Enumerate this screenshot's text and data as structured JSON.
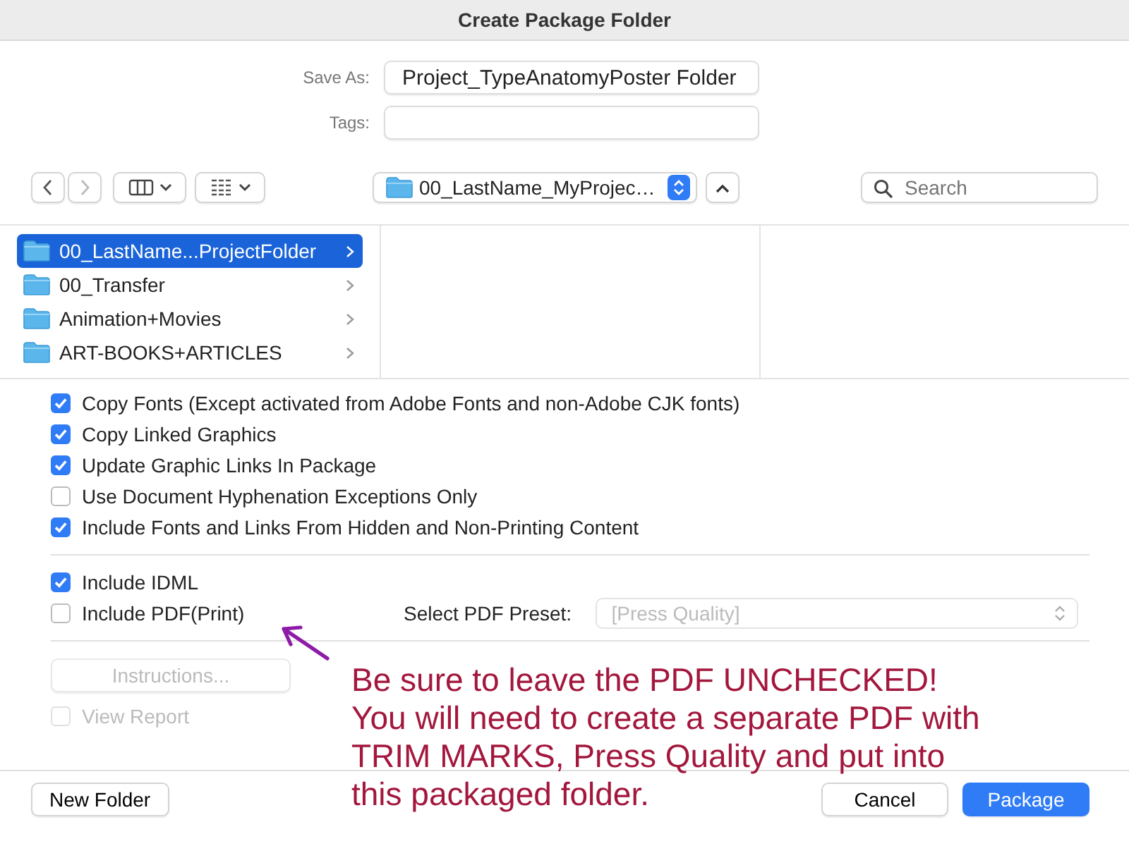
{
  "window": {
    "title": "Create Package Folder"
  },
  "save_as": {
    "label": "Save As:",
    "value": "Project_TypeAnatomyPoster Folder"
  },
  "tags": {
    "label": "Tags:"
  },
  "toolbar": {
    "location": "00_LastName_MyProjec…",
    "search": {
      "placeholder": "Search"
    }
  },
  "browser": {
    "items": [
      {
        "name": "00_LastName...ProjectFolder",
        "selected": true
      },
      {
        "name": "00_Transfer",
        "selected": false
      },
      {
        "name": "Animation+Movies",
        "selected": false
      },
      {
        "name": "ART-BOOKS+ARTICLES",
        "selected": false
      }
    ]
  },
  "options": [
    {
      "label": "Copy Fonts (Except activated from Adobe Fonts and non-Adobe CJK fonts)",
      "checked": true
    },
    {
      "label": "Copy Linked Graphics",
      "checked": true
    },
    {
      "label": "Update Graphic Links In Package",
      "checked": true
    },
    {
      "label": "Use Document Hyphenation Exceptions Only",
      "checked": false
    },
    {
      "label": "Include Fonts and Links From Hidden and Non-Printing Content",
      "checked": true
    }
  ],
  "include": [
    {
      "label": "Include IDML",
      "checked": true
    },
    {
      "label": "Include PDF(Print)",
      "checked": false
    }
  ],
  "pdf_preset": {
    "label": "Select PDF Preset:",
    "value": "[Press Quality]",
    "disabled": true
  },
  "instructions_button": {
    "label": "Instructions...",
    "disabled": true
  },
  "view_report": {
    "label": "View Report",
    "checked": false,
    "disabled": true
  },
  "annotation": {
    "lines": [
      "Be sure to leave the PDF UNCHECKED!",
      "You will need to create a separate PDF with",
      "TRIM MARKS, Press Quality and put into",
      "this packaged folder."
    ]
  },
  "buttons": {
    "new_folder": "New Folder",
    "cancel": "Cancel",
    "package": "Package"
  }
}
